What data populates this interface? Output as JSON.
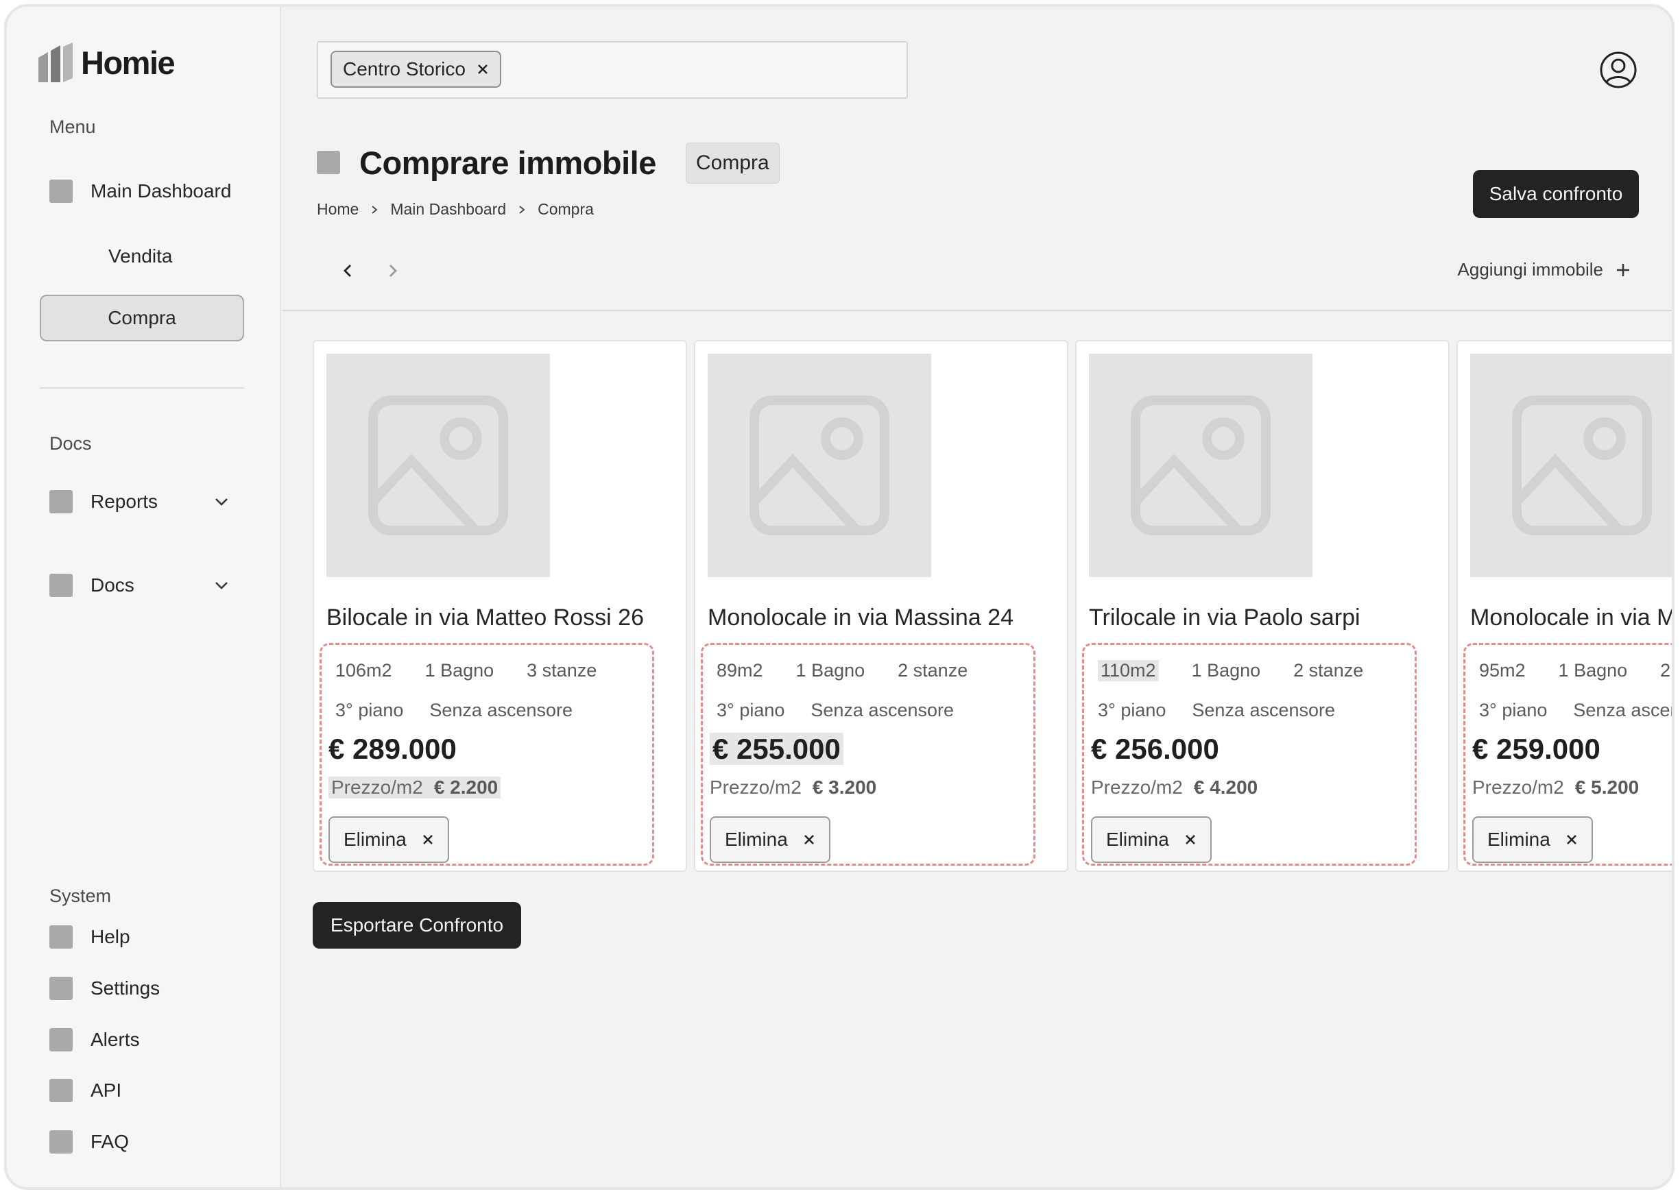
{
  "app": {
    "name": "Homie"
  },
  "sidebar": {
    "menu_label": "Menu",
    "main_dashboard": "Main Dashboard",
    "sub_items": [
      "Vendita",
      "Compra"
    ],
    "docs_label": "Docs",
    "docs_items": [
      "Reports",
      "Docs"
    ],
    "system_label": "System",
    "system_items": [
      "Help",
      "Settings",
      "Alerts",
      "API",
      "FAQ"
    ]
  },
  "search": {
    "chip": "Centro Storico"
  },
  "page": {
    "title": "Comprare immobile",
    "tag": "Compra",
    "breadcrumb": [
      "Home",
      "Main Dashboard",
      "Compra"
    ],
    "save_button": "Salva confronto",
    "add_property": "Aggiungi immobile",
    "export_button": "Esportare Confronto"
  },
  "cards": [
    {
      "title": "Bilocale in via  Matteo Rossi 26",
      "area": "106m2",
      "bath": "1 Bagno",
      "rooms": "3 stanze",
      "floor": "3° piano",
      "elevator": "Senza ascensore",
      "price": "€ 289.000",
      "ppm_label": "Prezzo/m2",
      "ppm_value": "€ 2.200",
      "delete": "Elimina"
    },
    {
      "title": "Monolocale in via Massina 24",
      "area": "89m2",
      "bath": "1 Bagno",
      "rooms": "2 stanze",
      "floor": "3° piano",
      "elevator": "Senza ascensore",
      "price": "€ 255.000",
      "ppm_label": "Prezzo/m2",
      "ppm_value": "€ 3.200",
      "delete": "Elimina"
    },
    {
      "title": "Trilocale in via Paolo sarpi",
      "area": "110m2",
      "bath": "1 Bagno",
      "rooms": "2 stanze",
      "floor": "3° piano",
      "elevator": "Senza ascensore",
      "price": "€ 256.000",
      "ppm_label": "Prezzo/m2",
      "ppm_value": "€ 4.200",
      "delete": "Elimina"
    },
    {
      "title": "Monolocale in via M",
      "area": "95m2",
      "bath": "1 Bagno",
      "rooms": "2",
      "floor": "3° piano",
      "elevator": "Senza ascer",
      "price": "€ 259.000",
      "ppm_label": "Prezzo/m2",
      "ppm_value": "€ 5.200",
      "delete": "Elimina"
    }
  ],
  "icons": {
    "logo": "homie-logo-icon",
    "chip_remove": "close-icon",
    "avatar": "user-icon",
    "breadcrumb_sep": "chevron-right-icon",
    "prev": "chevron-left-icon",
    "next": "chevron-right-icon",
    "add": "plus-icon",
    "image": "image-placeholder-icon",
    "expand": "chevron-down-icon"
  },
  "colors": {
    "dark_button": "#232323",
    "dashed_highlight": "#e58b8b",
    "placeholder": "#e3e3e3",
    "nav_square": "#a9a9a9"
  }
}
